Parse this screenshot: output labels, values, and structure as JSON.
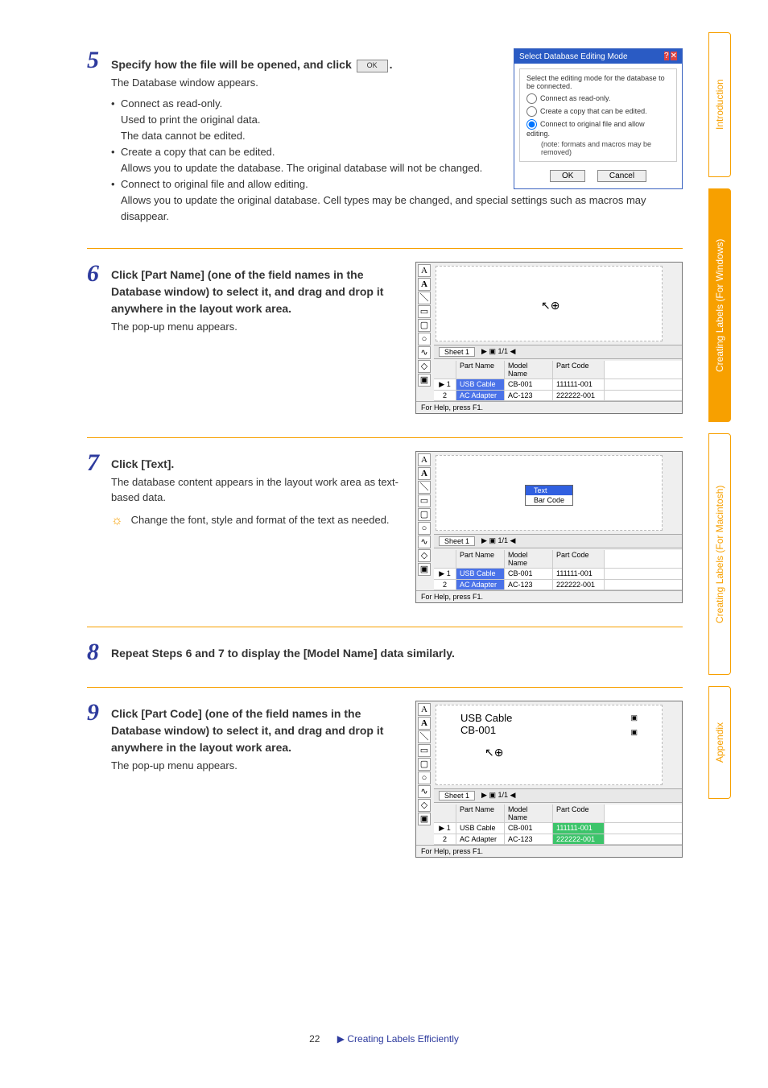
{
  "sideTabs": {
    "intro": "Introduction",
    "win": "Creating Labels (For Windows)",
    "mac": "Creating Labels (For Macintosh)",
    "appx": "Appendix"
  },
  "steps": {
    "s5": {
      "num": "5",
      "head_a": "Specify how the file will be opened, and click ",
      "head_b": ".",
      "ok_label": "OK",
      "p1": "The Database window appears.",
      "li1": "Connect as read-only.",
      "li1a": "Used to print the original data.",
      "li1b": "The data cannot be edited.",
      "li2": "Create a copy that can be edited.",
      "li2a": "Allows you to update the database. The original database will not be changed.",
      "li3": "Connect to original file and allow editing.",
      "li3a": "Allows you to update the original database. Cell types may be changed, and special settings such as macros may disappear."
    },
    "s6": {
      "num": "6",
      "head": "Click [Part Name] (one of the field names in the Database window) to select it, and drag and drop it anywhere in the layout work area.",
      "p1": "The pop-up menu appears."
    },
    "s7": {
      "num": "7",
      "head": "Click [Text].",
      "p1": "The database content appears in the layout work area as text-based data.",
      "tip": "Change the font, style and format of the text as needed."
    },
    "s8": {
      "num": "8",
      "head": "Repeat Steps 6 and 7 to display the [Model Name] data similarly."
    },
    "s9": {
      "num": "9",
      "head": "Click [Part Code] (one of the field names in the Database window) to select it, and drag and drop it anywhere in the layout work area.",
      "p1": "The pop-up menu appears."
    }
  },
  "dialog": {
    "title": "Select Database Editing Mode",
    "legend": "Select the editing mode for the database to be connected.",
    "opt1": "Connect as read-only.",
    "opt2": "Create a copy that can be edited.",
    "opt3": "Connect to original file and allow editing.",
    "opt3note": "(note: formats and macros may be removed)",
    "btn_ok": "OK",
    "btn_cancel": "Cancel"
  },
  "editor": {
    "sheet": "Sheet 1",
    "paging": "1/1",
    "head": {
      "c1": "Part Name",
      "c2": "Model Name",
      "c3": "Part Code"
    },
    "rows": [
      {
        "n": "1",
        "c1": "USB Cable",
        "c2": "CB-001",
        "c3": "111111-001"
      },
      {
        "n": "2",
        "c1": "AC Adapter",
        "c2": "AC-123",
        "c3": "222222-001"
      }
    ],
    "status": "For Help, press F1.",
    "menu": {
      "text": "Text",
      "barcode": "Bar Code"
    },
    "card": {
      "l1": "USB Cable",
      "l2": "CB-001"
    }
  },
  "footer": {
    "page": "22",
    "crumb": "Creating Labels Efficiently"
  }
}
